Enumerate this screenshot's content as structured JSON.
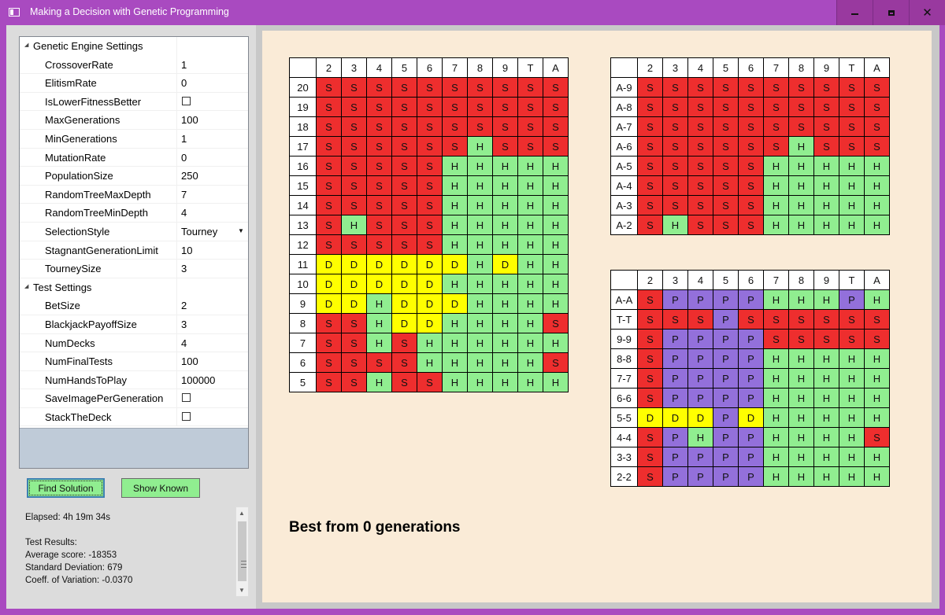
{
  "window": {
    "title": "Making a Decision with Genetic Programming"
  },
  "property_grid": {
    "categories": [
      {
        "name": "Genetic Engine Settings",
        "items": [
          {
            "name": "CrossoverRate",
            "value": "1"
          },
          {
            "name": "ElitismRate",
            "value": "0"
          },
          {
            "name": "IsLowerFitnessBetter",
            "type": "checkbox",
            "checked": false
          },
          {
            "name": "MaxGenerations",
            "value": "100"
          },
          {
            "name": "MinGenerations",
            "value": "1"
          },
          {
            "name": "MutationRate",
            "value": "0"
          },
          {
            "name": "PopulationSize",
            "value": "250"
          },
          {
            "name": "RandomTreeMaxDepth",
            "value": "7"
          },
          {
            "name": "RandomTreeMinDepth",
            "value": "4"
          },
          {
            "name": "SelectionStyle",
            "value": "Tourney",
            "type": "dropdown"
          },
          {
            "name": "StagnantGenerationLimit",
            "value": "10"
          },
          {
            "name": "TourneySize",
            "value": "3"
          }
        ]
      },
      {
        "name": "Test Settings",
        "items": [
          {
            "name": "BetSize",
            "value": "2"
          },
          {
            "name": "BlackjackPayoffSize",
            "value": "3"
          },
          {
            "name": "NumDecks",
            "value": "4"
          },
          {
            "name": "NumFinalTests",
            "value": "100"
          },
          {
            "name": "NumHandsToPlay",
            "value": "100000"
          },
          {
            "name": "SaveImagePerGeneration",
            "type": "checkbox",
            "checked": false
          },
          {
            "name": "StackTheDeck",
            "type": "checkbox",
            "checked": false
          }
        ]
      }
    ]
  },
  "buttons": {
    "find_solution": "Find Solution",
    "show_known": "Show Known"
  },
  "results": {
    "elapsed": "Elapsed: 4h 19m 34s",
    "header": "Test Results:",
    "average": "Average score: -18353",
    "stddev": "Standard Deviation: 679",
    "coeff": "Coeff. of Variation: -0.0370"
  },
  "colors": {
    "S": "#ee2e2e",
    "H": "#90ee90",
    "D": "#ffff00",
    "P": "#9370db"
  },
  "dealer_columns": [
    "2",
    "3",
    "4",
    "5",
    "6",
    "7",
    "8",
    "9",
    "T",
    "A"
  ],
  "hard_table": {
    "rows": [
      {
        "label": "20",
        "cells": "SSSSSSSSSS"
      },
      {
        "label": "19",
        "cells": "SSSSSSSSSS"
      },
      {
        "label": "18",
        "cells": "SSSSSSSSSS"
      },
      {
        "label": "17",
        "cells": "SSSSSSHSSS"
      },
      {
        "label": "16",
        "cells": "SSSSSHHHHH"
      },
      {
        "label": "15",
        "cells": "SSSSSHHHHH"
      },
      {
        "label": "14",
        "cells": "SSSSSHHHHH"
      },
      {
        "label": "13",
        "cells": "SHSSSHHHHH"
      },
      {
        "label": "12",
        "cells": "SSSSSHHHHH"
      },
      {
        "label": "11",
        "cells": "DDDDDDHDHH"
      },
      {
        "label": "10",
        "cells": "DDDDDHHHHH"
      },
      {
        "label": "9",
        "cells": "DDHDDDHHHH"
      },
      {
        "label": "8",
        "cells": "SSHDDHHHHS"
      },
      {
        "label": "7",
        "cells": "SSHSHHHHHH"
      },
      {
        "label": "6",
        "cells": "SSSSHHHHHS"
      },
      {
        "label": "5",
        "cells": "SSHSSHHHHH"
      }
    ]
  },
  "soft_table": {
    "rows": [
      {
        "label": "A-9",
        "cells": "SSSSSSSSSS"
      },
      {
        "label": "A-8",
        "cells": "SSSSSSSSSS"
      },
      {
        "label": "A-7",
        "cells": "SSSSSSSSSS"
      },
      {
        "label": "A-6",
        "cells": "SSSSSSHSSS"
      },
      {
        "label": "A-5",
        "cells": "SSSSSHHHHH"
      },
      {
        "label": "A-4",
        "cells": "SSSSSHHHHH"
      },
      {
        "label": "A-3",
        "cells": "SSSSSHHHHH"
      },
      {
        "label": "A-2",
        "cells": "SHSSSHHHHH"
      }
    ]
  },
  "pair_table": {
    "rows": [
      {
        "label": "A-A",
        "cells": "SPPPPHHHPH"
      },
      {
        "label": "T-T",
        "cells": "SSSPSSSSSS"
      },
      {
        "label": "9-9",
        "cells": "SPPPPSSSSS"
      },
      {
        "label": "8-8",
        "cells": "SPPPPHHHHH"
      },
      {
        "label": "7-7",
        "cells": "SPPPPHHHHH"
      },
      {
        "label": "6-6",
        "cells": "SPPPPHHHHH"
      },
      {
        "label": "5-5",
        "cells": "DDDPDHHHHH"
      },
      {
        "label": "4-4",
        "cells": "SPHPPHHHHS"
      },
      {
        "label": "3-3",
        "cells": "SPPPPHHHHH"
      },
      {
        "label": "2-2",
        "cells": "SPPPPHHHHH"
      }
    ]
  },
  "caption": "Best from 0 generations"
}
